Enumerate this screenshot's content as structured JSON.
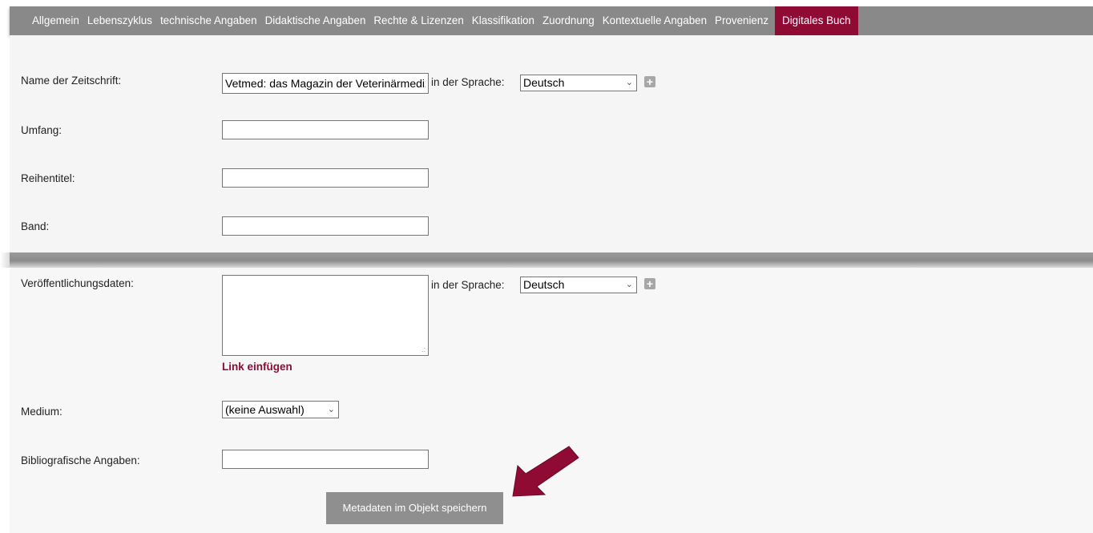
{
  "tabs": [
    {
      "label": "Allgemein",
      "active": false
    },
    {
      "label": "Lebenszyklus",
      "active": false
    },
    {
      "label": "technische Angaben",
      "active": false
    },
    {
      "label": "Didaktische Angaben",
      "active": false
    },
    {
      "label": "Rechte & Lizenzen",
      "active": false
    },
    {
      "label": "Klassifikation",
      "active": false
    },
    {
      "label": "Zuordnung",
      "active": false
    },
    {
      "label": "Kontextuelle Angaben",
      "active": false
    },
    {
      "label": "Provenienz",
      "active": false
    },
    {
      "label": "Digitales Buch",
      "active": true
    }
  ],
  "form": {
    "zeitschrift": {
      "label": "Name der Zeitschrift:",
      "value": "Vetmed: das Magazin der Veterinärmedizinischen Universität Wien"
    },
    "umfang": {
      "label": "Umfang:",
      "value": ""
    },
    "reihentitel": {
      "label": "Reihentitel:",
      "value": ""
    },
    "band": {
      "label": "Band:",
      "value": ""
    },
    "veroeffentlichung": {
      "label": "Veröffentlichungsdaten:",
      "value": ""
    },
    "link_label": "Link einfügen",
    "medium": {
      "label": "Medium:",
      "selected": "(keine Auswahl)"
    },
    "bibliografie": {
      "label": "Bibliografische Angaben:",
      "value": ""
    },
    "language_label": "in der Sprache:",
    "language_value": "Deutsch",
    "save_label": "Metadaten im Objekt speichern"
  },
  "colors": {
    "accent": "#8f0b33",
    "tabbar": "#898989",
    "button": "#8f8f8f"
  },
  "icons": {
    "add": "plus-icon",
    "dropdown": "chevron-down-icon",
    "annotation": "arrow-icon"
  }
}
